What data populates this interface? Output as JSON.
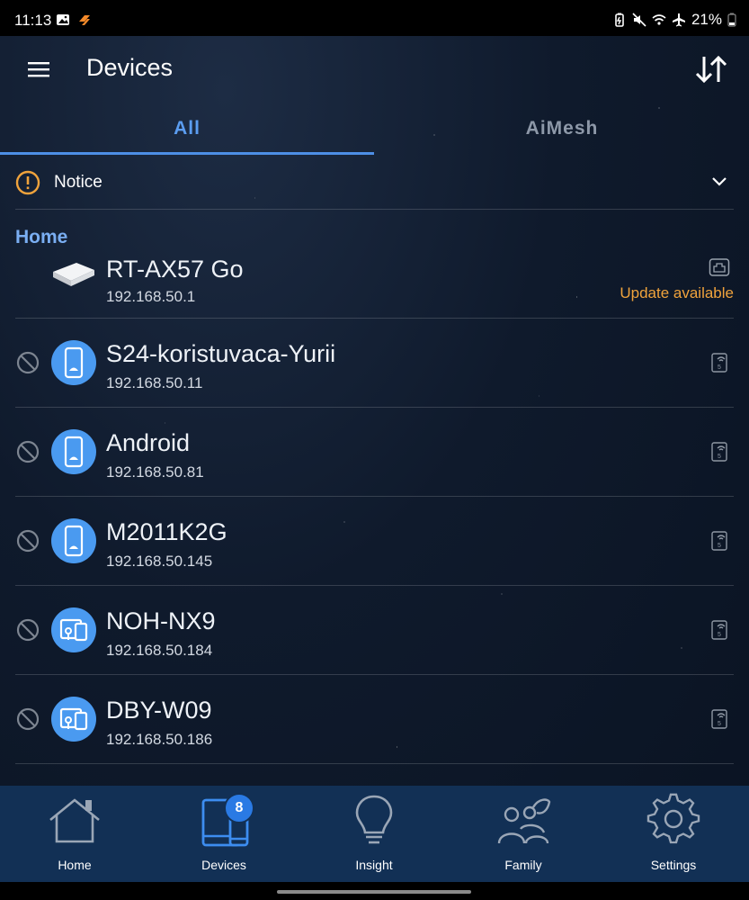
{
  "status_bar": {
    "time": "11:13",
    "battery": "21%"
  },
  "app_bar": {
    "title": "Devices"
  },
  "tabs": [
    {
      "label": "All"
    },
    {
      "label": "AiMesh"
    }
  ],
  "notice": {
    "label": "Notice"
  },
  "section": {
    "title": "Home"
  },
  "router": {
    "name": "RT-AX57 Go",
    "ip": "192.168.50.1",
    "status": "Update available"
  },
  "devices": [
    {
      "name": "S24-koristuvaca-Yurii",
      "ip": "192.168.50.11",
      "icon": "phone-icon"
    },
    {
      "name": "Android",
      "ip": "192.168.50.81",
      "icon": "phone-icon"
    },
    {
      "name": "M2011K2G",
      "ip": "192.168.50.145",
      "icon": "phone-icon"
    },
    {
      "name": "NOH-NX9",
      "ip": "192.168.50.184",
      "icon": "multi-device-icon"
    },
    {
      "name": "DBY-W09",
      "ip": "192.168.50.186",
      "icon": "multi-device-icon"
    }
  ],
  "bottom_nav": [
    {
      "label": "Home",
      "icon": "house-icon"
    },
    {
      "label": "Devices",
      "icon": "devices-icon",
      "badge": "8"
    },
    {
      "label": "Insight",
      "icon": "lightbulb-icon"
    },
    {
      "label": "Family",
      "icon": "family-icon"
    },
    {
      "label": "Settings",
      "icon": "gear-icon"
    }
  ],
  "colors": {
    "accent": "#4d8fe6",
    "section_title": "#7aaef2",
    "warning": "#f0a33c",
    "avatar": "#4a9af0",
    "nav_background": "#123055"
  }
}
